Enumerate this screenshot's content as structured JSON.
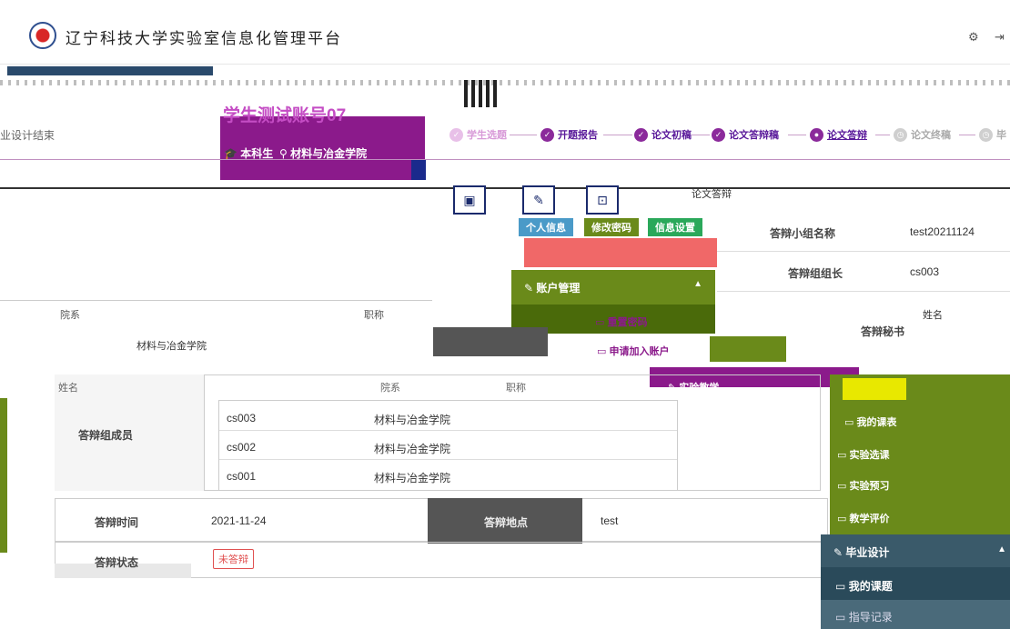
{
  "header": {
    "title": "辽宁科技大学实验室信息化管理平台",
    "gear_icon": "gear-icon",
    "logout_icon": "logout-icon"
  },
  "prev_step": "业设计结束",
  "student": {
    "name": "学生测试账号07",
    "level": "本科生",
    "college": "材料与冶金学院"
  },
  "steps": [
    {
      "label": "学生选题",
      "state": "done-light"
    },
    {
      "label": "开题报告",
      "state": "done"
    },
    {
      "label": "论文初稿",
      "state": "done"
    },
    {
      "label": "论文答辩稿",
      "state": "done"
    },
    {
      "label": "论文答辩",
      "state": "current"
    },
    {
      "label": "论文终稿",
      "state": "pending"
    },
    {
      "label": "毕",
      "state": "pending"
    }
  ],
  "tab_label": "论文答辩",
  "tags": [
    "个人信息",
    "修改密码",
    "信息设置"
  ],
  "menu": {
    "account": "账户管理",
    "reset": "重置密码",
    "apply": "申请加入账户",
    "experiment": "实验教学"
  },
  "info": {
    "group_name_label": "答辩小组名称",
    "group_name": "test20211124",
    "leader_label": "答辩组组长",
    "leader": "cs003",
    "secretary_label": "答辩秘书",
    "name_col": "姓名"
  },
  "left_table": {
    "dept_header": "院系",
    "title_header": "职称",
    "row_college": "材料与冶金学院"
  },
  "members": {
    "label": "答辩组成员",
    "col_name": "姓名",
    "col_dept": "院系",
    "col_title": "职称",
    "rows": [
      {
        "id": "cs003",
        "college": "材料与冶金学院"
      },
      {
        "id": "cs002",
        "college": "材料与冶金学院"
      },
      {
        "id": "cs001",
        "college": "材料与冶金学院"
      }
    ]
  },
  "time": {
    "label": "答辩时间",
    "value": "2021-11-24",
    "place_label": "答辩地点",
    "place": "test"
  },
  "status": {
    "label": "答辩状态",
    "value": "未答辩"
  },
  "sidebar": {
    "items": [
      "我的课表",
      "实验选课",
      "实验预习",
      "教学评价"
    ],
    "grad": "毕业设计",
    "topic": "我的课题",
    "guide": "指导记录"
  }
}
